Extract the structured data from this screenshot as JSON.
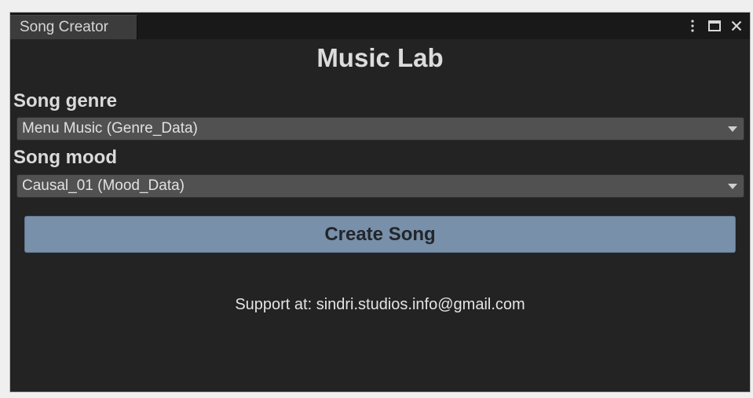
{
  "window": {
    "tab_title": "Song Creator"
  },
  "title_controls": {
    "more_icon": "kebab-vertical-icon",
    "maximize_icon": "maximize-icon",
    "close_icon": "close-icon"
  },
  "main": {
    "heading": "Music Lab",
    "genre": {
      "label": "Song genre",
      "selected": "Menu Music (Genre_Data)"
    },
    "mood": {
      "label": "Song mood",
      "selected": "Causal_01 (Mood_Data)"
    },
    "create_button_label": "Create Song",
    "support_text": "Support at: sindri.studios.info@gmail.com"
  },
  "colors": {
    "background": "#232323",
    "titlebar": "#191919",
    "tab": "#3c3c3c",
    "dropdown": "#515151",
    "accent_button": "#7890a9"
  }
}
